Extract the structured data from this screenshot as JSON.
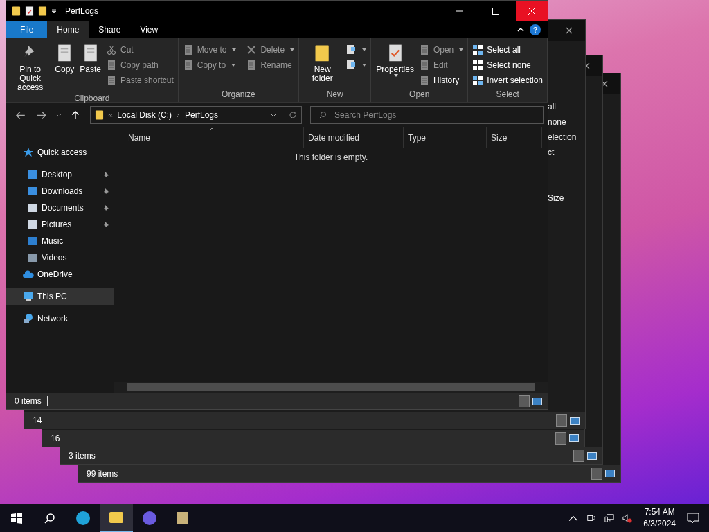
{
  "background_windows": [
    {
      "status": "14",
      "partial_texts": [
        "all",
        "none",
        "election",
        "ct",
        "Size"
      ]
    },
    {
      "status": "16"
    },
    {
      "status": "3 items"
    },
    {
      "status": "99 items"
    }
  ],
  "help_button": "?",
  "window": {
    "title": "PerfLogs"
  },
  "tabs": [
    {
      "label": "File",
      "kind": "file",
      "selected": false
    },
    {
      "label": "Home",
      "kind": "tab",
      "selected": true
    },
    {
      "label": "Share",
      "kind": "tab",
      "selected": false
    },
    {
      "label": "View",
      "kind": "tab",
      "selected": false
    }
  ],
  "ribbon": [
    {
      "label": "Clipboard",
      "items": [
        {
          "kind": "large",
          "label": "Pin to Quick access",
          "dropdown": false,
          "disabled": false
        },
        {
          "kind": "large",
          "label": "Copy",
          "dropdown": false,
          "disabled": false
        },
        {
          "kind": "large",
          "label": "Paste",
          "dropdown": false,
          "disabled": false
        },
        {
          "kind": "small",
          "label": "Cut",
          "dropdown": false,
          "disabled": true
        },
        {
          "kind": "small",
          "label": "Copy path",
          "dropdown": false,
          "disabled": true
        },
        {
          "kind": "small",
          "label": "Paste shortcut",
          "dropdown": false,
          "disabled": true
        }
      ]
    },
    {
      "label": "Organize",
      "items": [
        {
          "kind": "small",
          "label": "Move to",
          "dropdown": true,
          "disabled": true
        },
        {
          "kind": "small",
          "label": "Copy to",
          "dropdown": true,
          "disabled": true
        },
        {
          "kind": "small",
          "label": "Delete",
          "dropdown": true,
          "disabled": true
        },
        {
          "kind": "small",
          "label": "Rename",
          "dropdown": false,
          "disabled": true
        }
      ]
    },
    {
      "label": "New",
      "items": [
        {
          "kind": "large",
          "label": "New folder",
          "dropdown": false,
          "disabled": false
        },
        {
          "kind": "icon",
          "dropdown": true,
          "disabled": false
        },
        {
          "kind": "icon",
          "dropdown": true,
          "disabled": false
        }
      ]
    },
    {
      "label": "Open",
      "items": [
        {
          "kind": "large",
          "label": "Properties",
          "dropdown": true,
          "disabled": false
        },
        {
          "kind": "small",
          "label": "Open",
          "dropdown": true,
          "disabled": true
        },
        {
          "kind": "small",
          "label": "Edit",
          "dropdown": false,
          "disabled": true
        },
        {
          "kind": "small",
          "label": "History",
          "dropdown": false,
          "disabled": false
        }
      ]
    },
    {
      "label": "Select",
      "items": [
        {
          "kind": "small",
          "label": "Select all",
          "dropdown": false,
          "disabled": false
        },
        {
          "kind": "small",
          "label": "Select none",
          "dropdown": false,
          "disabled": false
        },
        {
          "kind": "small",
          "label": "Invert selection",
          "dropdown": false,
          "disabled": false
        }
      ]
    }
  ],
  "address": {
    "breadcrumb": [
      "Local Disk (C:)",
      "PerfLogs"
    ]
  },
  "search": {
    "placeholder": "Search PerfLogs"
  },
  "nav": [
    {
      "label": "Quick access",
      "selected": false,
      "children": [
        {
          "label": "Desktop",
          "pinned": true,
          "selected": false
        },
        {
          "label": "Downloads",
          "pinned": true,
          "selected": false
        },
        {
          "label": "Documents",
          "pinned": true,
          "selected": false
        },
        {
          "label": "Pictures",
          "pinned": true,
          "selected": false
        },
        {
          "label": "Music",
          "pinned": false,
          "selected": false
        },
        {
          "label": "Videos",
          "pinned": false,
          "selected": false
        }
      ]
    },
    {
      "label": "OneDrive",
      "selected": false
    },
    {
      "label": "This PC",
      "selected": true
    },
    {
      "label": "Network",
      "selected": false
    }
  ],
  "columns": [
    {
      "label": "Name",
      "sorted": true
    },
    {
      "label": "Date modified",
      "sorted": false
    },
    {
      "label": "Type",
      "sorted": false
    },
    {
      "label": "Size",
      "sorted": false
    }
  ],
  "empty_message": "This folder is empty.",
  "status_bar": {
    "count": "0 items"
  },
  "taskbar": {
    "apps": [
      {
        "kind": "edge",
        "active": false
      },
      {
        "kind": "explorer",
        "active": true
      },
      {
        "kind": "firefox",
        "active": false
      },
      {
        "kind": "archive",
        "active": false
      }
    ],
    "time": "7:54 AM",
    "date": "6/3/2024"
  }
}
